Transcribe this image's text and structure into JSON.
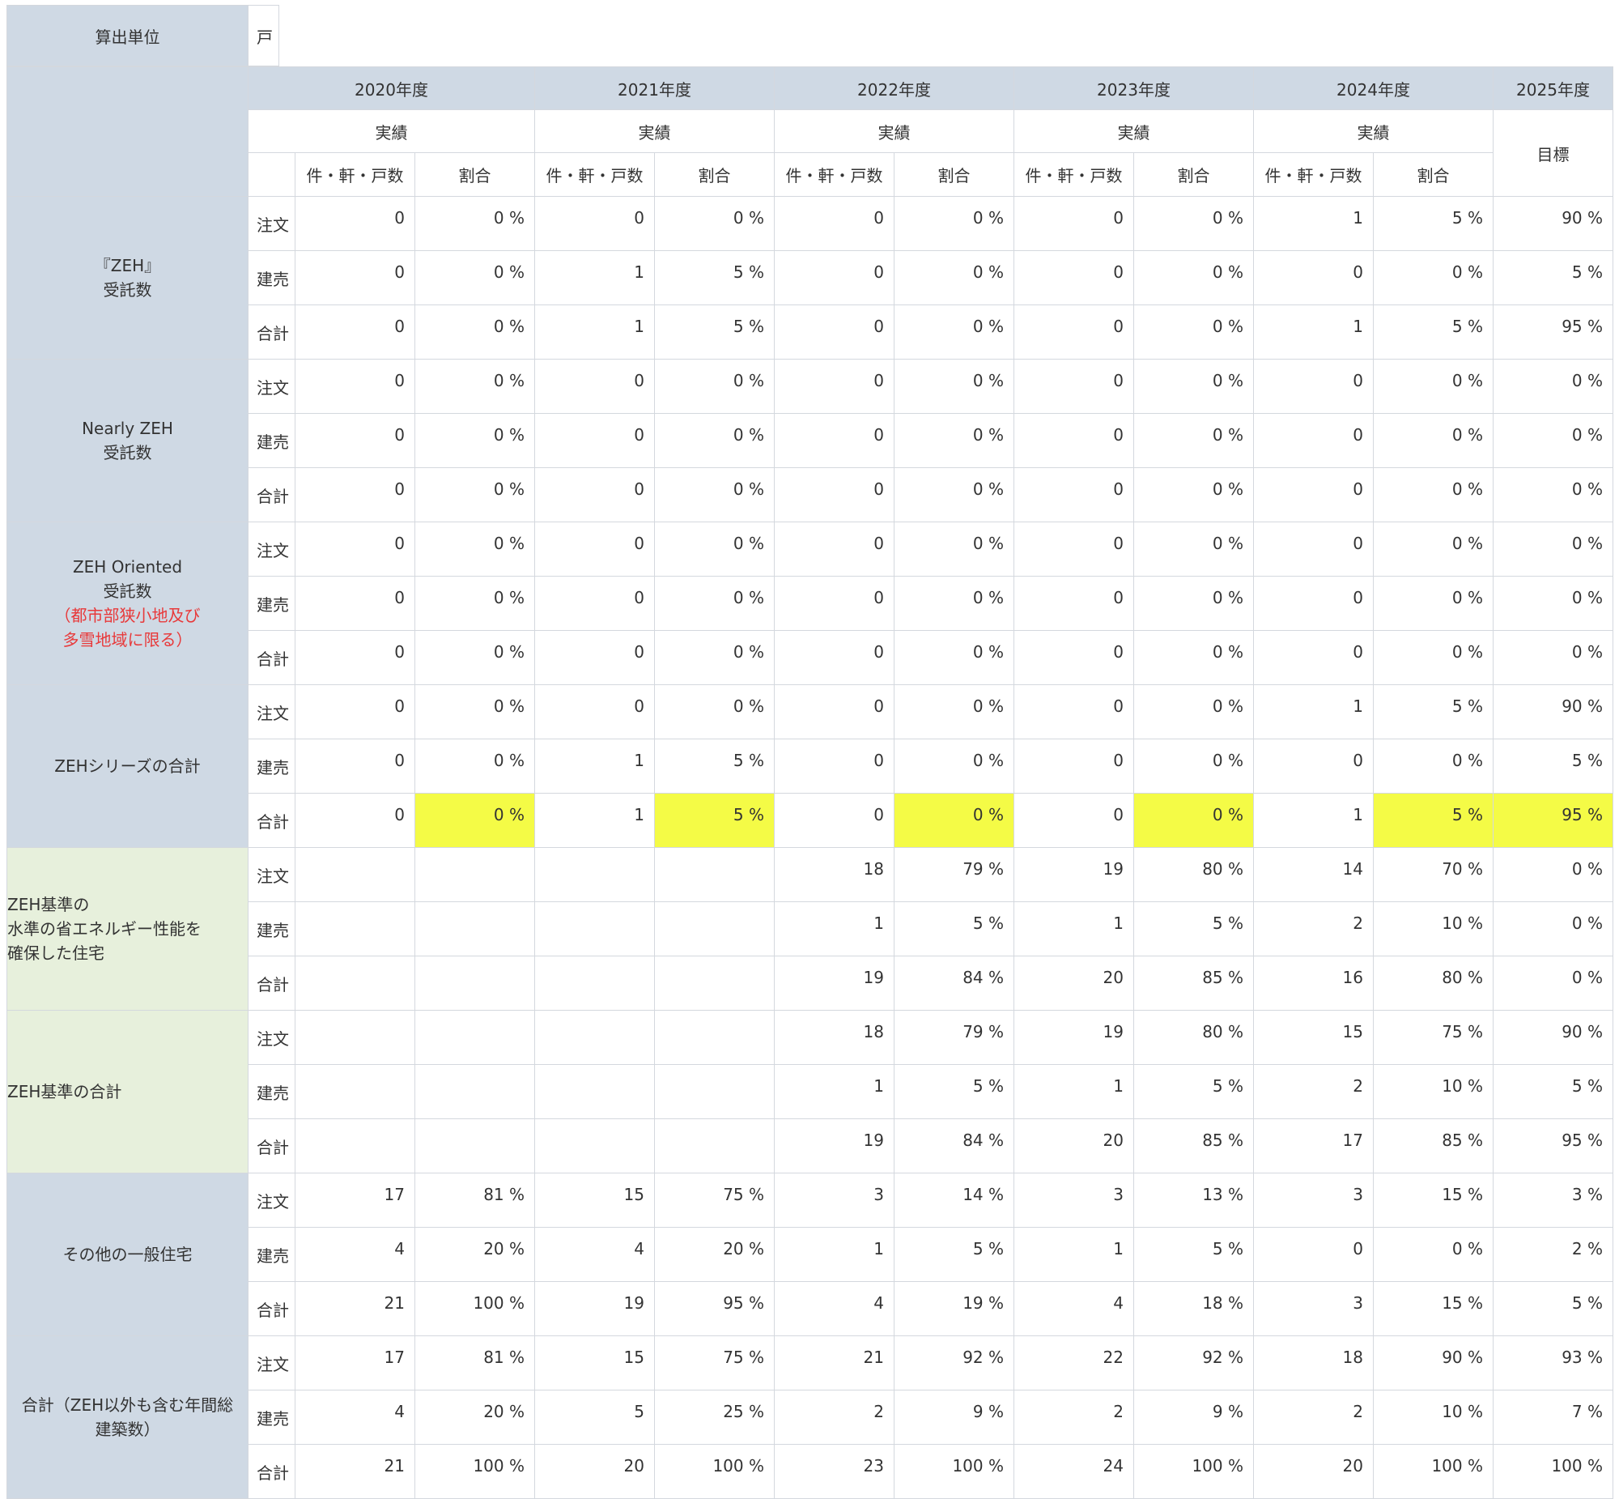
{
  "unit": {
    "label": "算出単位",
    "value": "戸"
  },
  "header": {
    "years": [
      "2020年度",
      "2021年度",
      "2022年度",
      "2023年度",
      "2024年度",
      "2025年度"
    ],
    "actual": "実績",
    "target": "目標",
    "count_col": "件・軒・戸数",
    "ratio_col": "割合"
  },
  "colors": {
    "header_bg": "#cfd9e4",
    "green_bg": "#e7f0dc",
    "highlight": "#f4fb46",
    "note_red": "#e8393a"
  },
  "groups": [
    {
      "label": [
        "『ZEH』",
        "受託数"
      ],
      "bg": "blue",
      "rows": [
        {
          "kind": "注文",
          "cells": [
            "0",
            "0 %",
            "0",
            "0 %",
            "0",
            "0 %",
            "0",
            "0 %",
            "1",
            "5 %",
            "90 %"
          ]
        },
        {
          "kind": "建売",
          "cells": [
            "0",
            "0 %",
            "1",
            "5 %",
            "0",
            "0 %",
            "0",
            "0 %",
            "0",
            "0 %",
            "5 %"
          ]
        },
        {
          "kind": "合計",
          "cells": [
            "0",
            "0 %",
            "1",
            "5 %",
            "0",
            "0 %",
            "0",
            "0 %",
            "1",
            "5 %",
            "95 %"
          ]
        }
      ]
    },
    {
      "label": [
        "Nearly ZEH",
        "受託数"
      ],
      "bg": "blue",
      "rows": [
        {
          "kind": "注文",
          "cells": [
            "0",
            "0 %",
            "0",
            "0 %",
            "0",
            "0 %",
            "0",
            "0 %",
            "0",
            "0 %",
            "0 %"
          ]
        },
        {
          "kind": "建売",
          "cells": [
            "0",
            "0 %",
            "0",
            "0 %",
            "0",
            "0 %",
            "0",
            "0 %",
            "0",
            "0 %",
            "0 %"
          ]
        },
        {
          "kind": "合計",
          "cells": [
            "0",
            "0 %",
            "0",
            "0 %",
            "0",
            "0 %",
            "0",
            "0 %",
            "0",
            "0 %",
            "0 %"
          ]
        }
      ]
    },
    {
      "label": [
        "ZEH Oriented",
        "受託数"
      ],
      "note": [
        "（都市部狭小地及び",
        "多雪地域に限る）"
      ],
      "bg": "blue",
      "rows": [
        {
          "kind": "注文",
          "cells": [
            "0",
            "0 %",
            "0",
            "0 %",
            "0",
            "0 %",
            "0",
            "0 %",
            "0",
            "0 %",
            "0 %"
          ]
        },
        {
          "kind": "建売",
          "cells": [
            "0",
            "0 %",
            "0",
            "0 %",
            "0",
            "0 %",
            "0",
            "0 %",
            "0",
            "0 %",
            "0 %"
          ]
        },
        {
          "kind": "合計",
          "cells": [
            "0",
            "0 %",
            "0",
            "0 %",
            "0",
            "0 %",
            "0",
            "0 %",
            "0",
            "0 %",
            "0 %"
          ]
        }
      ]
    },
    {
      "label": [
        "ZEHシリーズの合計"
      ],
      "bg": "blue",
      "rows": [
        {
          "kind": "注文",
          "cells": [
            "0",
            "0 %",
            "0",
            "0 %",
            "0",
            "0 %",
            "0",
            "0 %",
            "1",
            "5 %",
            "90 %"
          ]
        },
        {
          "kind": "建売",
          "cells": [
            "0",
            "0 %",
            "1",
            "5 %",
            "0",
            "0 %",
            "0",
            "0 %",
            "0",
            "0 %",
            "5 %"
          ]
        },
        {
          "kind": "合計",
          "cells": [
            "0",
            "0 %",
            "1",
            "5 %",
            "0",
            "0 %",
            "0",
            "0 %",
            "1",
            "5 %",
            "95 %"
          ],
          "highlight": true
        }
      ]
    },
    {
      "label": [
        "ZEH基準の",
        "水準の省エネルギー性能を",
        "確保した住宅"
      ],
      "bg": "green",
      "rows": [
        {
          "kind": "注文",
          "cells": [
            "",
            "",
            "",
            "",
            "18",
            "79 %",
            "19",
            "80 %",
            "14",
            "70 %",
            "0 %"
          ]
        },
        {
          "kind": "建売",
          "cells": [
            "",
            "",
            "",
            "",
            "1",
            "5 %",
            "1",
            "5 %",
            "2",
            "10 %",
            "0 %"
          ]
        },
        {
          "kind": "合計",
          "cells": [
            "",
            "",
            "",
            "",
            "19",
            "84 %",
            "20",
            "85 %",
            "16",
            "80 %",
            "0 %"
          ]
        }
      ]
    },
    {
      "label": [
        "ZEH基準の合計"
      ],
      "bg": "green",
      "rows": [
        {
          "kind": "注文",
          "cells": [
            "",
            "",
            "",
            "",
            "18",
            "79 %",
            "19",
            "80 %",
            "15",
            "75 %",
            "90 %"
          ]
        },
        {
          "kind": "建売",
          "cells": [
            "",
            "",
            "",
            "",
            "1",
            "5 %",
            "1",
            "5 %",
            "2",
            "10 %",
            "5 %"
          ]
        },
        {
          "kind": "合計",
          "cells": [
            "",
            "",
            "",
            "",
            "19",
            "84 %",
            "20",
            "85 %",
            "17",
            "85 %",
            "95 %"
          ]
        }
      ]
    },
    {
      "label": [
        "その他の一般住宅"
      ],
      "bg": "blue",
      "rows": [
        {
          "kind": "注文",
          "cells": [
            "17",
            "81 %",
            "15",
            "75 %",
            "3",
            "14 %",
            "3",
            "13 %",
            "3",
            "15 %",
            "3 %"
          ]
        },
        {
          "kind": "建売",
          "cells": [
            "4",
            "20 %",
            "4",
            "20 %",
            "1",
            "5 %",
            "1",
            "5 %",
            "0",
            "0 %",
            "2 %"
          ]
        },
        {
          "kind": "合計",
          "cells": [
            "21",
            "100 %",
            "19",
            "95 %",
            "4",
            "19 %",
            "4",
            "18 %",
            "3",
            "15 %",
            "5 %"
          ]
        }
      ]
    },
    {
      "label": [
        "合計（ZEH以外も含む年間総",
        "建築数）"
      ],
      "bg": "blue",
      "rows": [
        {
          "kind": "注文",
          "cells": [
            "17",
            "81 %",
            "15",
            "75 %",
            "21",
            "92 %",
            "22",
            "92 %",
            "18",
            "90 %",
            "93 %"
          ]
        },
        {
          "kind": "建売",
          "cells": [
            "4",
            "20 %",
            "5",
            "25 %",
            "2",
            "9 %",
            "2",
            "9 %",
            "2",
            "10 %",
            "7 %"
          ]
        },
        {
          "kind": "合計",
          "cells": [
            "21",
            "100 %",
            "20",
            "100 %",
            "23",
            "100 %",
            "24",
            "100 %",
            "20",
            "100 %",
            "100 %"
          ]
        }
      ]
    }
  ]
}
